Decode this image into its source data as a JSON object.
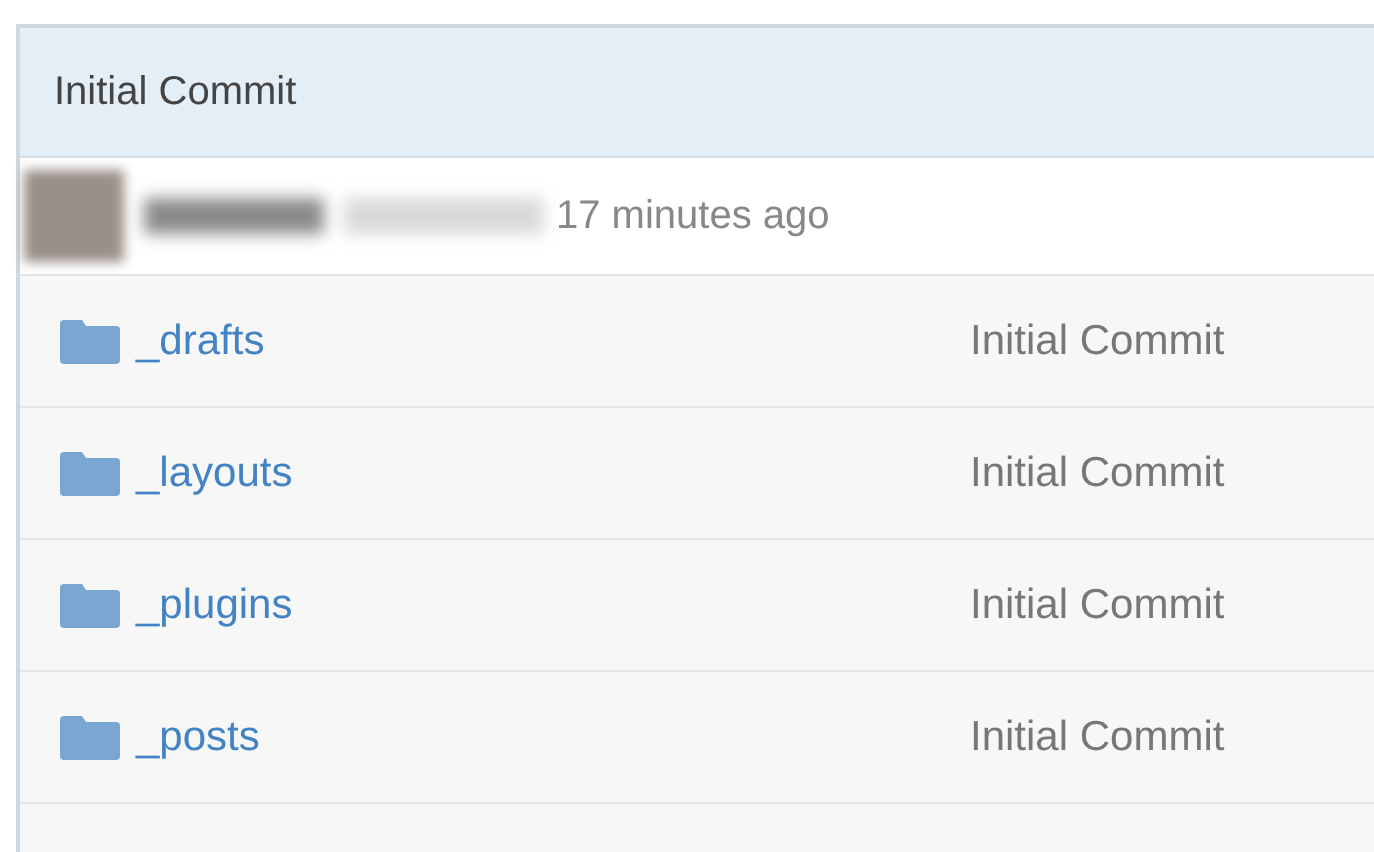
{
  "commit": {
    "title": "Initial Commit",
    "age": "17 minutes ago"
  },
  "files": [
    {
      "kind": "folder",
      "name": "_drafts",
      "message": "Initial Commit"
    },
    {
      "kind": "folder",
      "name": "_layouts",
      "message": "Initial Commit"
    },
    {
      "kind": "folder",
      "name": "_plugins",
      "message": "Initial Commit"
    },
    {
      "kind": "folder",
      "name": "_posts",
      "message": "Initial Commit"
    },
    {
      "kind": "cut"
    }
  ]
}
